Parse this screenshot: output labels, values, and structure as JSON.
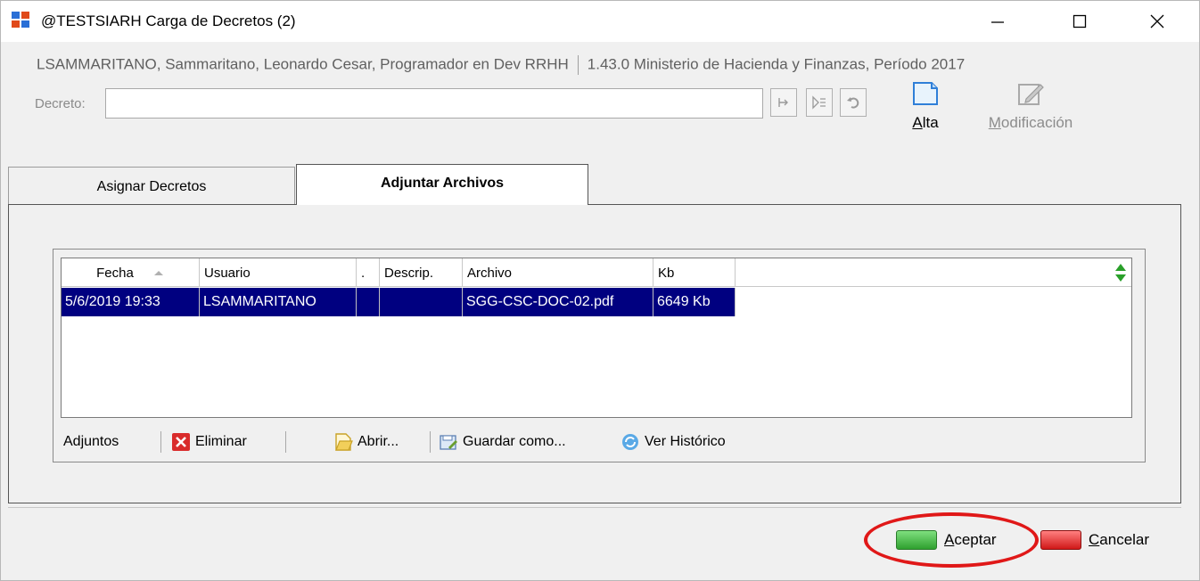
{
  "window": {
    "title": "@TESTSIARH Carga de Decretos (2)",
    "controls": {
      "minimize": "—",
      "maximize": "☐",
      "close": "✕"
    }
  },
  "user_line": {
    "user": "LSAMMARITANO, Sammaritano, Leonardo Cesar, Programador en Dev RRHH",
    "context": "1.43.0 Ministerio de Hacienda y Finanzas, Período 2017"
  },
  "decreto": {
    "label": "Decreto:",
    "value": ""
  },
  "actions": {
    "alta": "Alta",
    "modificacion": "Modificación"
  },
  "tabs": [
    {
      "label": "Asignar Decretos",
      "active": false
    },
    {
      "label": "Adjuntar Archivos",
      "active": true
    }
  ],
  "grid": {
    "columns": [
      "Fecha",
      "Usuario",
      ".",
      "Descrip.",
      "Archivo",
      "Kb"
    ],
    "rows": [
      {
        "fecha": "5/6/2019 19:33",
        "usuario": "LSAMMARITANO",
        "dot": "",
        "descrip": "",
        "archivo": "SGG-CSC-DOC-02.pdf",
        "kb": "6649 Kb",
        "selected": true
      }
    ]
  },
  "toolbar": {
    "adjuntos": "Adjuntos",
    "eliminar": "Eliminar",
    "abrir": "Abrir...",
    "guardar": "Guardar como...",
    "historico": "Ver Histórico"
  },
  "footer": {
    "aceptar": "Aceptar",
    "cancelar": "Cancelar"
  },
  "colors": {
    "selection": "#000080",
    "accept": "#3fbf3f",
    "cancel": "#e02020",
    "highlight": "#e01818"
  }
}
